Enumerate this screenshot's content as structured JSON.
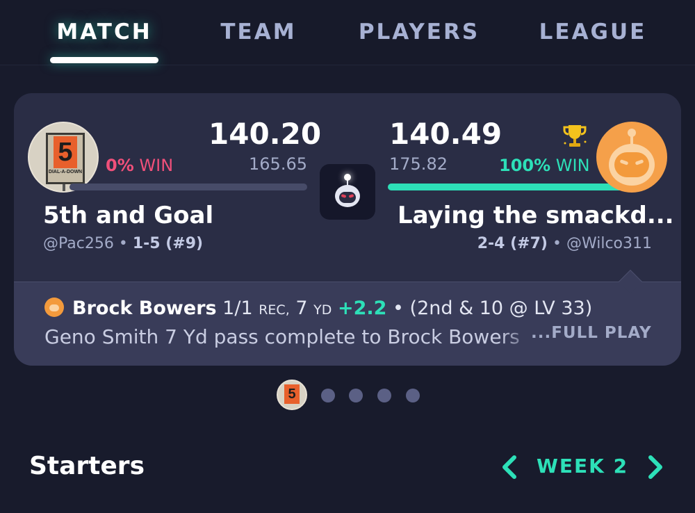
{
  "tabs": [
    {
      "label": "MATCH",
      "active": true
    },
    {
      "label": "TEAM",
      "active": false
    },
    {
      "label": "PLAYERS",
      "active": false
    },
    {
      "label": "LEAGUE",
      "active": false
    }
  ],
  "matchup": {
    "left": {
      "score": "140.20",
      "projected": "165.65",
      "win_pct": "0%",
      "win_label": "WIN",
      "win_fraction": 0,
      "team_name": "5th and Goal",
      "handle": "@Pac256",
      "separator": "•",
      "record": "1-5 (#9)",
      "avatar_text": "5",
      "avatar_subtext": "DIAL-A-DOWN"
    },
    "right": {
      "score": "140.49",
      "projected": "175.82",
      "win_pct": "100%",
      "win_label": "WIN",
      "win_fraction": 1,
      "team_name": "Laying the smackd...",
      "handle": "@Wilco311",
      "separator": "•",
      "record": "2-4 (#7)",
      "winner_icon": "trophy-icon"
    }
  },
  "play": {
    "player": "Brock Bowers",
    "stat_count": "1/1",
    "stat_rec": "REC,",
    "stat_yds_num": "7",
    "stat_yds_unit": "YD",
    "points": "+2.2",
    "bullet": "•",
    "situation": "(2nd & 10 @ LV 33)",
    "description": "Geno Smith 7 Yd pass complete to Brock Bowers",
    "full_play_label": "...FULL PLAY"
  },
  "pager": {
    "mini_avatar_text": "5",
    "dot_count": 4
  },
  "starters": {
    "title": "Starters",
    "week_label": "WEEK 2"
  },
  "colors": {
    "accent": "#2de0b8",
    "loss": "#f0507a",
    "background": "#181b2c",
    "card": "#2a2d45"
  }
}
